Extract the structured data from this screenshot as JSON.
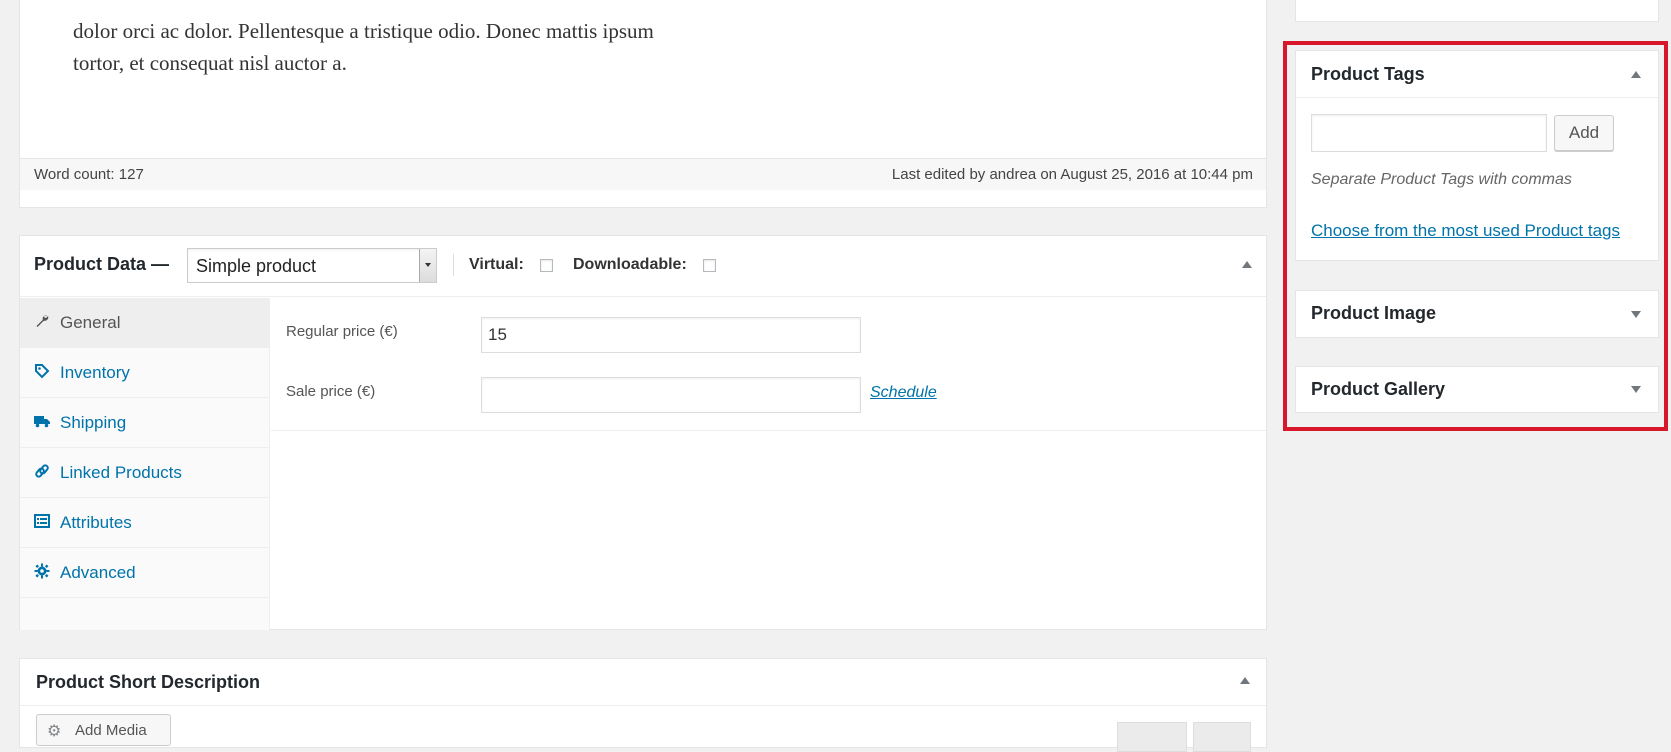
{
  "editor": {
    "text_lines": [
      "dolor orci ac dolor. Pellentesque a tristique odio. Donec mattis ipsum",
      "tortor, et consequat nisl auctor a."
    ],
    "word_count": "Word count: 127",
    "last_edited": "Last edited by andrea on August 25, 2016 at 10:44 pm"
  },
  "product_data": {
    "title": "Product Data —",
    "type_select": "Simple product",
    "virtual_label": "Virtual:",
    "downloadable_label": "Downloadable:",
    "tabs": [
      {
        "label": "General",
        "icon": "wrench-icon",
        "active": true
      },
      {
        "label": "Inventory",
        "icon": "tag-icon"
      },
      {
        "label": "Shipping",
        "icon": "truck-icon"
      },
      {
        "label": "Linked Products",
        "icon": "link-icon"
      },
      {
        "label": "Attributes",
        "icon": "list-icon"
      },
      {
        "label": "Advanced",
        "icon": "gear-icon"
      }
    ],
    "regular_price_label": "Regular price (€)",
    "regular_price_value": "15",
    "sale_price_label": "Sale price (€)",
    "sale_price_value": "",
    "schedule_link": "Schedule"
  },
  "short_description": {
    "title": "Product Short Description",
    "add_media": "Add Media"
  },
  "sidebar": {
    "product_tags": {
      "title": "Product Tags",
      "add_button": "Add",
      "hint": "Separate Product Tags with commas",
      "most_used_link": "Choose from the most used Product tags"
    },
    "product_image": {
      "title": "Product Image"
    },
    "product_gallery": {
      "title": "Product Gallery"
    }
  },
  "colors": {
    "link": "#0073aa",
    "highlight": "#d7182a",
    "background": "#f1f1f1"
  }
}
